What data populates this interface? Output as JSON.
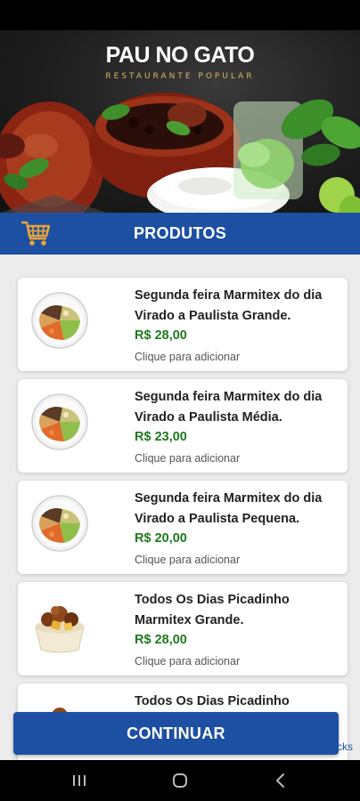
{
  "hero": {
    "brand_title": "PAU NO GATO",
    "brand_subtitle": "RESTAURANTE POPULAR"
  },
  "header": {
    "title": "PRODUTOS",
    "cart_icon": "cart-icon"
  },
  "products": [
    {
      "name_line1": "Segunda feira Marmitex do dia",
      "name_line2": "Virado a Paulista Grande.",
      "price": "R$ 28,00",
      "hint": "Clique para adicionar",
      "image": "marmitex-plate-image"
    },
    {
      "name_line1": "Segunda feira Marmitex do dia",
      "name_line2": "Virado a Paulista Média.",
      "price": "R$ 23,00",
      "hint": "Clique para adicionar",
      "image": "marmitex-plate-image"
    },
    {
      "name_line1": "Segunda feira Marmitex do dia",
      "name_line2": "Virado a Paulista Pequena.",
      "price": "R$ 20,00",
      "hint": "Clique para adicionar",
      "image": "marmitex-plate-image"
    },
    {
      "name_line1": "Todos Os Dias Picadinho",
      "name_line2": "Marmitex Grande.",
      "price": "R$ 28,00",
      "hint": "Clique para adicionar",
      "image": "picadinho-bowl-image"
    },
    {
      "name_line1": "Todos Os Dias Picadinho",
      "name_line2": "",
      "price": "",
      "hint": "",
      "image": "picadinho-bowl-image"
    }
  ],
  "footer": {
    "continue_label": "CONTINUAR",
    "side_link_fragment": "cks"
  },
  "nav": {
    "recents_icon": "recent-apps-icon",
    "home_icon": "home-icon",
    "back_icon": "back-icon"
  },
  "colors": {
    "primary_blue": "#1d4fa2",
    "price_green": "#1f7a1f",
    "cart_orange": "#e8a33a"
  }
}
